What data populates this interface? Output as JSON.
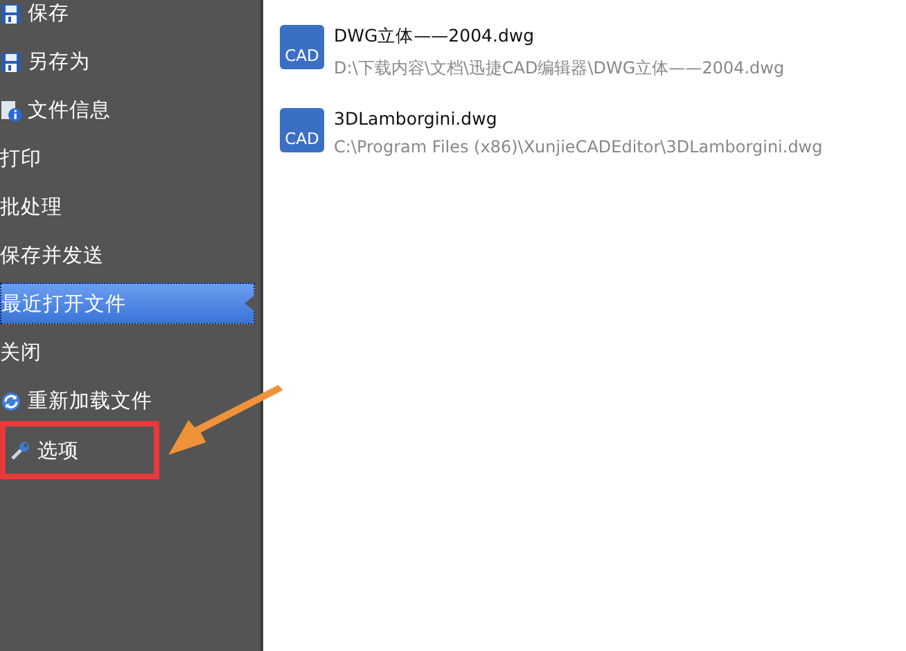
{
  "menu": {
    "items": [
      {
        "label": "保存",
        "kind": "save",
        "selected": false,
        "highlighted": false
      },
      {
        "label": "另存为",
        "kind": "save",
        "selected": false,
        "highlighted": false
      },
      {
        "label": "文件信息",
        "kind": "info",
        "selected": false,
        "highlighted": false
      },
      {
        "label": "打印",
        "kind": "plain",
        "selected": false,
        "highlighted": false
      },
      {
        "label": "批处理",
        "kind": "plain",
        "selected": false,
        "highlighted": false
      },
      {
        "label": "保存并发送",
        "kind": "plain",
        "selected": false,
        "highlighted": false
      },
      {
        "label": "最近打开文件",
        "kind": "plain",
        "selected": true,
        "highlighted": false
      },
      {
        "label": "关闭",
        "kind": "plain",
        "selected": false,
        "highlighted": false
      },
      {
        "label": "重新加载文件",
        "kind": "reload",
        "selected": false,
        "highlighted": false
      },
      {
        "label": "选项",
        "kind": "options",
        "selected": false,
        "highlighted": true
      }
    ]
  },
  "recent_files": [
    {
      "icon_text": "CAD",
      "name": "DWG立体——2004.dwg",
      "path": "D:\\下载内容\\文档\\迅捷CAD编辑器\\DWG立体——2004.dwg"
    },
    {
      "icon_text": "CAD",
      "name": "3DLamborgini.dwg",
      "path": "C:\\Program Files (x86)\\XunjieCADEditor\\3DLamborgini.dwg"
    }
  ]
}
